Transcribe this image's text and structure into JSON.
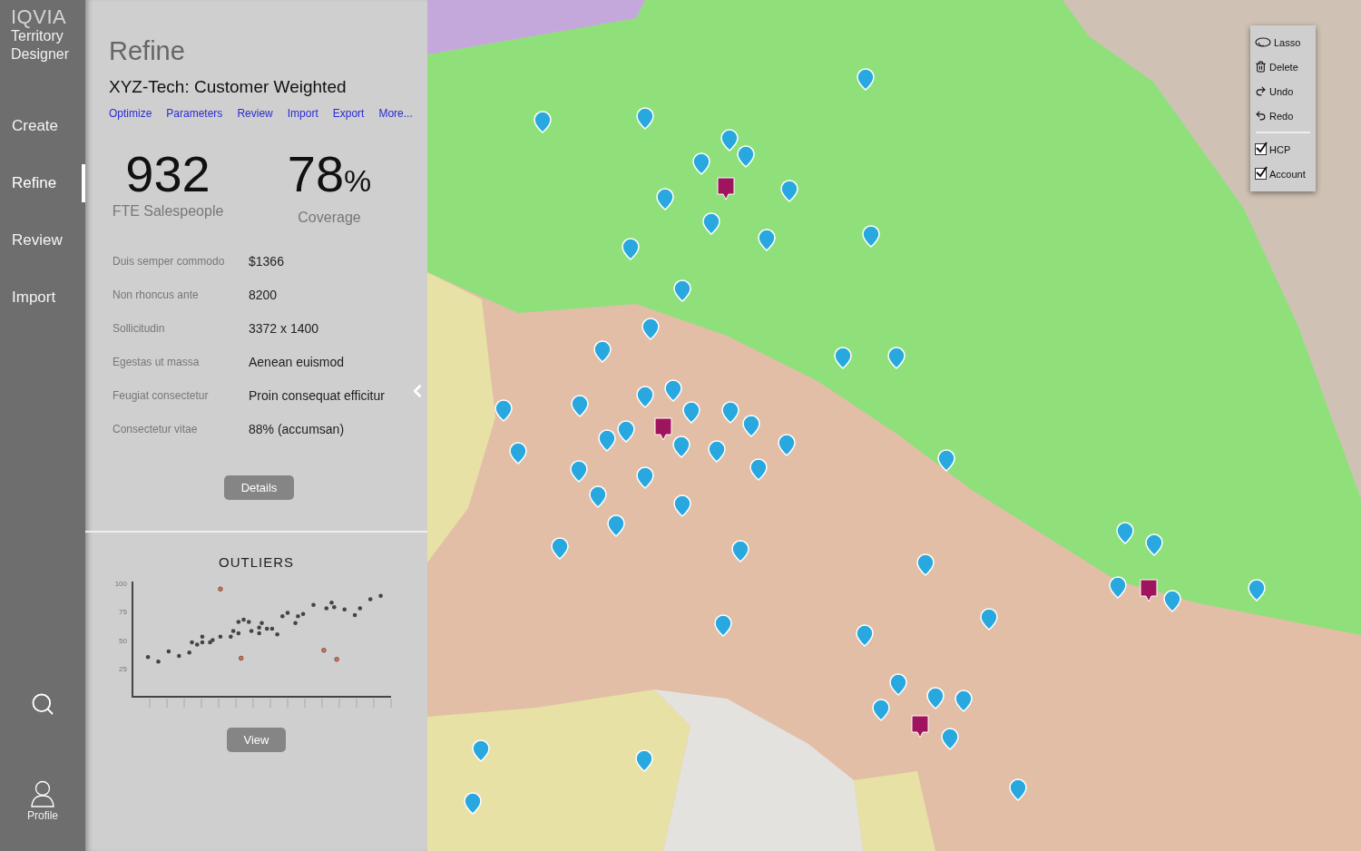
{
  "brand": {
    "logo": "IQVIA",
    "product": "Territory Designer"
  },
  "nav": {
    "items": [
      {
        "label": "Create",
        "selected": false
      },
      {
        "label": "Refine",
        "selected": true
      },
      {
        "label": "Review",
        "selected": false
      },
      {
        "label": "Import",
        "selected": false
      }
    ],
    "profile": "Profile"
  },
  "panel": {
    "title": "Refine",
    "subtitle": "XYZ-Tech: Customer Weighted",
    "links": [
      "Optimize",
      "Parameters",
      "Review",
      "Import",
      "Export",
      "More..."
    ],
    "stats": [
      {
        "value": "932",
        "label": "FTE Salespeople"
      },
      {
        "value": "78",
        "unit": "%",
        "label": "Coverage"
      }
    ],
    "details": [
      {
        "label": "Duis semper commodo",
        "value": "$1366"
      },
      {
        "label": "Non rhoncus ante",
        "value": "8200"
      },
      {
        "label": "Sollicitudin",
        "value": "3372 x 1400"
      },
      {
        "label": "Egestas ut massa",
        "value": "Aenean euismod"
      },
      {
        "label": "Feugiat consectetur",
        "value": "Proin consequat efficitur"
      },
      {
        "label": "Consectetur vitae",
        "value": "88% (accumsan)"
      }
    ],
    "details_button": "Details",
    "outliers": {
      "title": "OUTLIERS",
      "button": "View",
      "y_axis_labels": [
        "100",
        "75",
        "50",
        "25"
      ]
    }
  },
  "map_tools": [
    {
      "kind": "action",
      "label": "Lasso"
    },
    {
      "kind": "action",
      "label": "Delete"
    },
    {
      "kind": "action",
      "label": "Undo"
    },
    {
      "kind": "action",
      "label": "Redo"
    },
    {
      "kind": "checkbox",
      "label": "HCP",
      "checked": true
    },
    {
      "kind": "checkbox",
      "label": "Account",
      "checked": true
    }
  ]
}
